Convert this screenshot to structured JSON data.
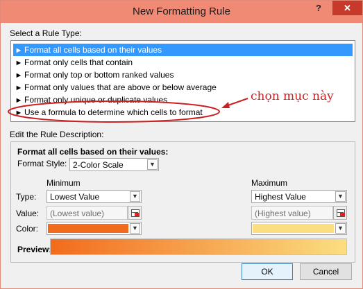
{
  "window": {
    "title": "New Formatting Rule",
    "help_glyph": "?",
    "close_glyph": "✕"
  },
  "rule_type": {
    "heading": "Select a Rule Type:",
    "items": [
      {
        "label": "Format all cells based on their values",
        "selected": true
      },
      {
        "label": "Format only cells that contain"
      },
      {
        "label": "Format only top or bottom ranked values"
      },
      {
        "label": "Format only values that are above or below average"
      },
      {
        "label": "Format only unique or duplicate values"
      },
      {
        "label": "Use a formula to determine which cells to format"
      }
    ],
    "arrow_glyph": "►"
  },
  "annotation": {
    "text": "chọn mục này",
    "color": "#cc2020"
  },
  "description": {
    "heading": "Edit the Rule Description:",
    "subheading": "Format all cells based on their values:",
    "format_style_label": "Format Style:",
    "format_style_value": "2-Color Scale",
    "minimum": {
      "heading": "Minimum",
      "type_label": "Type:",
      "type_value": "Lowest Value",
      "value_label": "Value:",
      "value_value": "(Lowest value)",
      "color_label": "Color:",
      "color": "#f26b1d"
    },
    "maximum": {
      "heading": "Maximum",
      "type_value": "Highest Value",
      "value_value": "(Highest value)",
      "color": "#fbde81"
    },
    "preview_label": "Preview:"
  },
  "buttons": {
    "ok": "OK",
    "cancel": "Cancel"
  },
  "colors": {
    "titlebar": "#f08a74",
    "close": "#c7392b",
    "selection": "#3399ff"
  }
}
